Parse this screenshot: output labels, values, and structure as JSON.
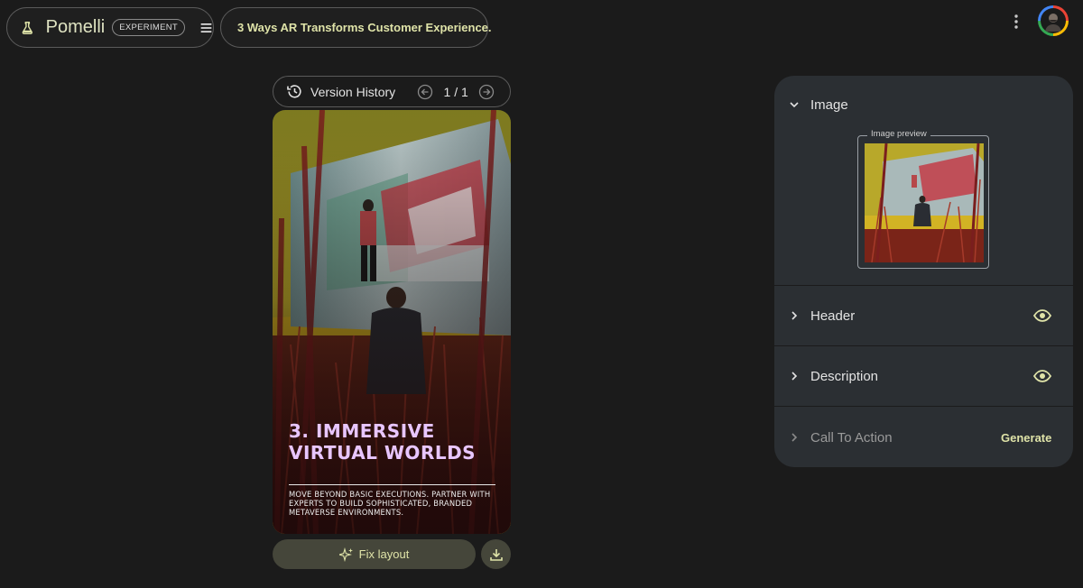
{
  "brand": {
    "name": "Pomelli",
    "badge": "EXPERIMENT",
    "logo_icon": "flask-icon",
    "menu_icon": "hamburger-menu-icon"
  },
  "header": {
    "back_icon": "arrow-left-icon",
    "title": "3 Ways AR Transforms Customer Experience."
  },
  "top_right": {
    "more_icon": "more-vert-icon",
    "avatar": "user-avatar"
  },
  "version": {
    "label": "Version History",
    "counter": "1 / 1",
    "history_icon": "history-icon",
    "prev_icon": "arrow-circle-left-icon",
    "next_icon": "arrow-circle-right-icon"
  },
  "card": {
    "heading_line1": "3. IMMERSIVE",
    "heading_line2": "VIRTUAL WORLDS",
    "description": "MOVE BEYOND BASIC EXECUTIONS. PARTNER WITH EXPERTS TO BUILD SOPHISTICATED, BRANDED METAVERSE ENVIRONMENTS."
  },
  "actions": {
    "fix_label": "Fix layout",
    "fix_icon": "sparkle-icon",
    "download_icon": "download-icon"
  },
  "panel": {
    "image": {
      "title": "Image",
      "preview_legend": "Image preview",
      "expanded": true
    },
    "header": {
      "title": "Header",
      "visible": true
    },
    "description": {
      "title": "Description",
      "visible": true
    },
    "cta": {
      "title": "Call To Action",
      "generate_label": "Generate"
    }
  },
  "colors": {
    "accent": "#dfe3a8",
    "panel_bg": "#2b2f33",
    "page_bg": "#1b1b1b",
    "heading_purple": "#e8c6ff"
  }
}
